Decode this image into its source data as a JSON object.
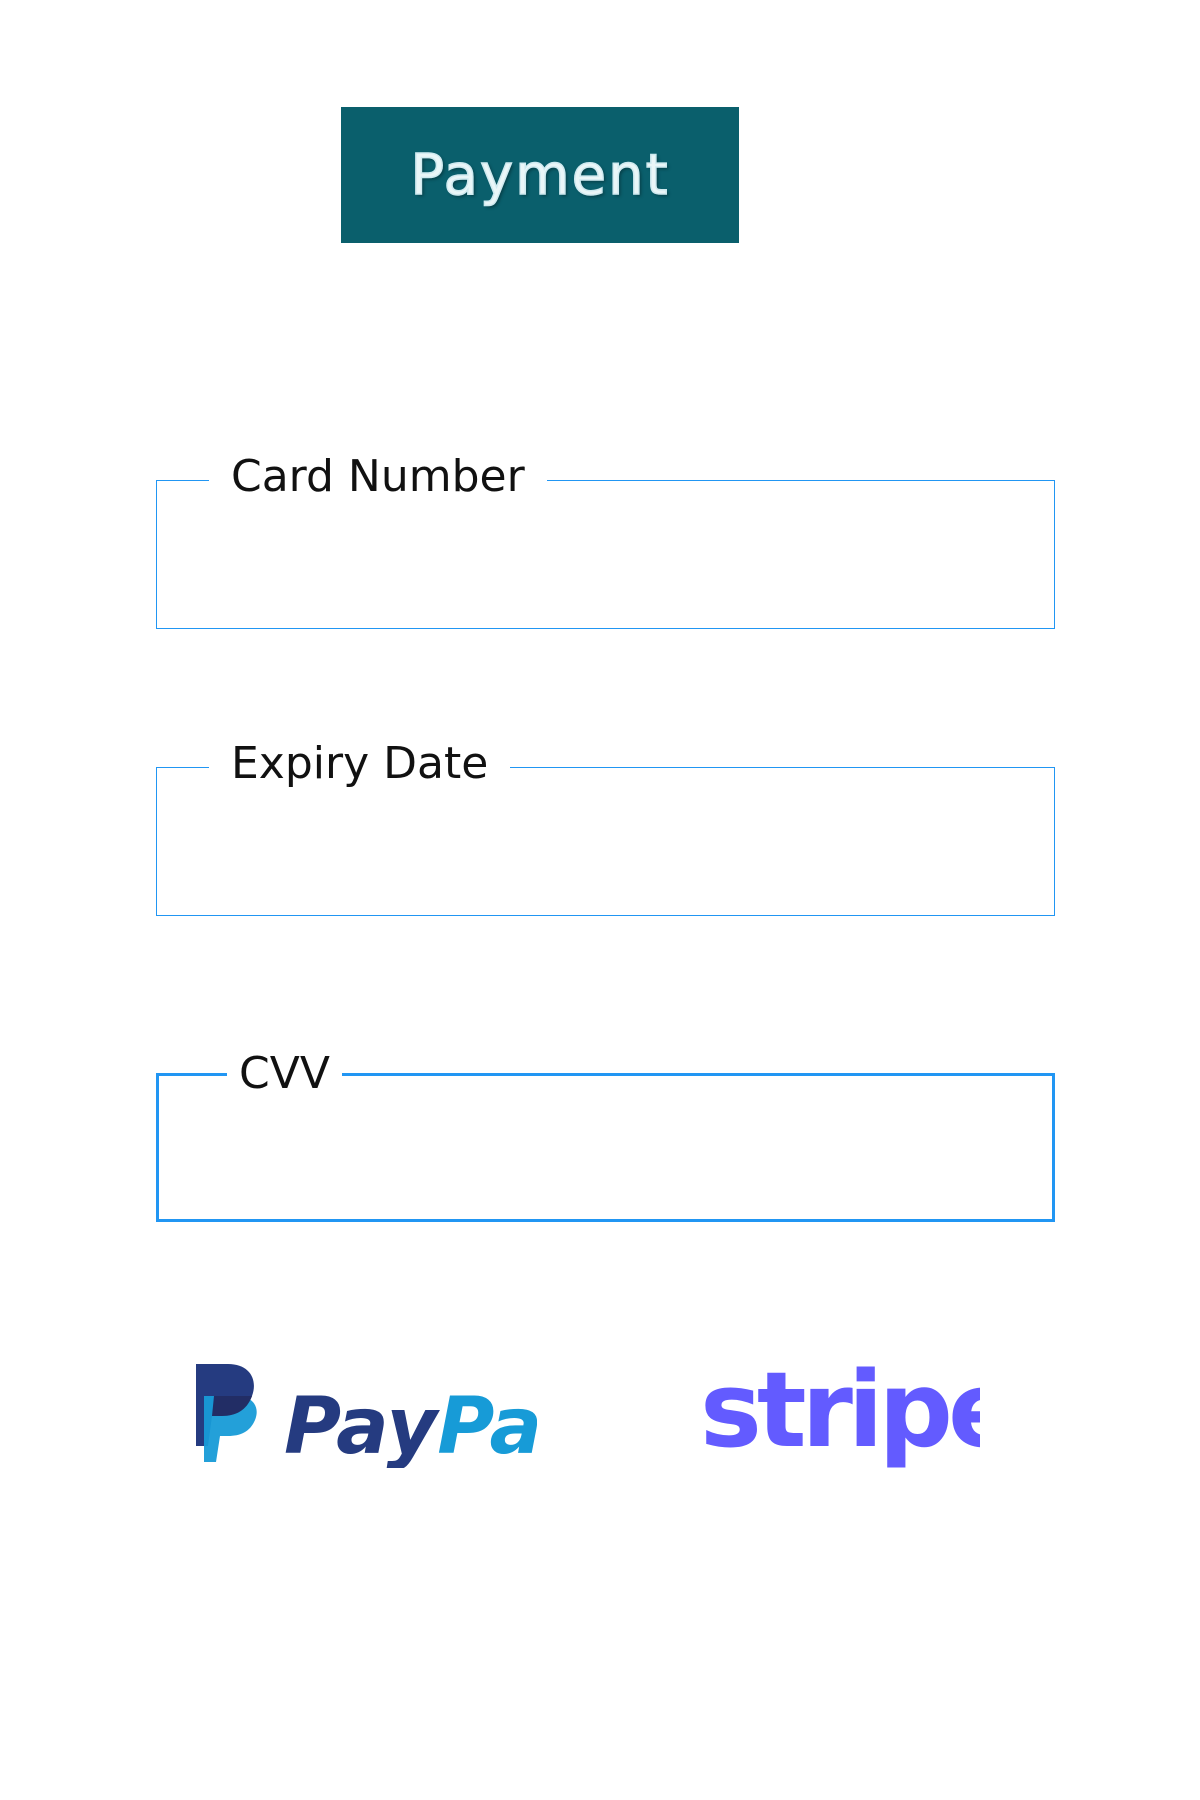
{
  "header": {
    "title": "Payment"
  },
  "form": {
    "fields": [
      {
        "id": "card_number",
        "label": "Card Number",
        "value": ""
      },
      {
        "id": "expiry_date",
        "label": "Expiry Date",
        "value": ""
      },
      {
        "id": "cvv",
        "label": "CVV",
        "value": ""
      }
    ],
    "focused_field": "cvv"
  },
  "payment_methods": {
    "paypal": {
      "label": "PayPal",
      "icon": "paypal-logo",
      "colors": {
        "dark": "#253b80",
        "light": "#179bd7"
      }
    },
    "stripe": {
      "label": "stripe",
      "icon": "stripe-logo",
      "color": "#635bff"
    }
  },
  "colors": {
    "title_background": "#0a5f6c",
    "field_border": "#2196f3"
  }
}
